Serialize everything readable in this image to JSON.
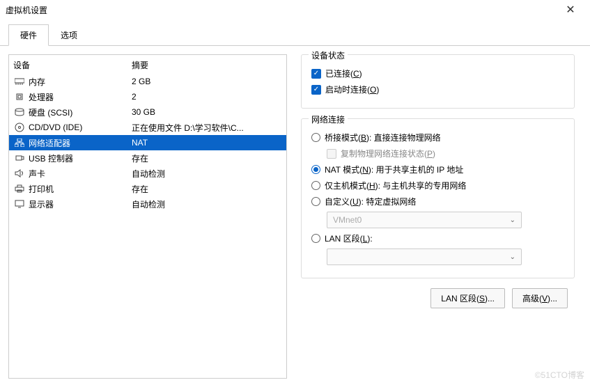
{
  "window": {
    "title": "虚拟机设置"
  },
  "tabs": {
    "hardware": "硬件",
    "options": "选项"
  },
  "cols": {
    "device": "设备",
    "summary": "摘要"
  },
  "devices": [
    {
      "name": "内存",
      "summary": "2 GB",
      "icon": "memory"
    },
    {
      "name": "处理器",
      "summary": "2",
      "icon": "cpu"
    },
    {
      "name": "硬盘 (SCSI)",
      "summary": "30 GB",
      "icon": "disk"
    },
    {
      "name": "CD/DVD (IDE)",
      "summary": "正在使用文件 D:\\学习软件\\C...",
      "icon": "cd"
    },
    {
      "name": "网络适配器",
      "summary": "NAT",
      "icon": "net"
    },
    {
      "name": "USB 控制器",
      "summary": "存在",
      "icon": "usb"
    },
    {
      "name": "声卡",
      "summary": "自动检测",
      "icon": "sound"
    },
    {
      "name": "打印机",
      "summary": "存在",
      "icon": "printer"
    },
    {
      "name": "显示器",
      "summary": "自动检测",
      "icon": "display"
    }
  ],
  "status": {
    "title": "设备状态",
    "connected": "已连接(C)",
    "connect_on": "启动时连接(O)"
  },
  "net": {
    "title": "网络连接",
    "bridge": "桥接模式(B): 直接连接物理网络",
    "replicate": "复制物理网络连接状态(P)",
    "nat": "NAT 模式(N): 用于共享主机的 IP 地址",
    "host": "仅主机模式(H): 与主机共享的专用网络",
    "custom": "自定义(U): 特定虚拟网络",
    "vmnet": "VMnet0",
    "lan": "LAN 区段(L):",
    "lan_combo": ""
  },
  "buttons": {
    "lanseg": "LAN 区段(S)...",
    "adv": "高级(V)..."
  },
  "watermark": "©51CTO博客"
}
